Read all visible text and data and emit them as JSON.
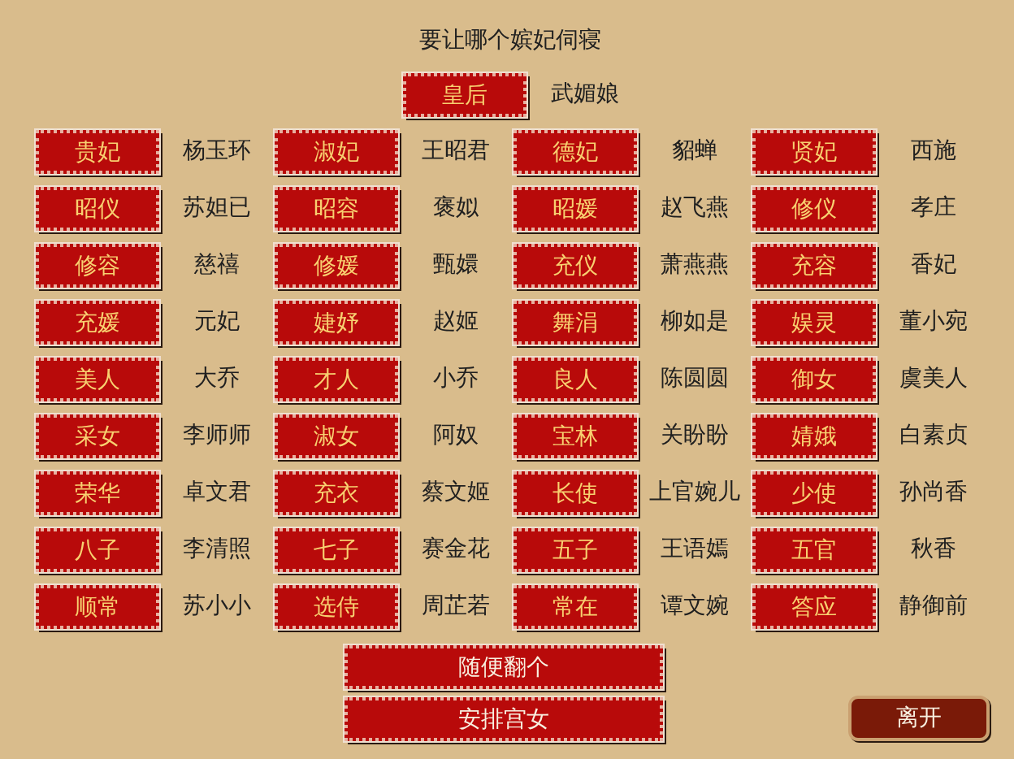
{
  "title": "要让哪个嫔妃伺寝",
  "featured": {
    "rank": "皇后",
    "name": "武媚娘"
  },
  "consorts": [
    {
      "rank": "贵妃",
      "name": "杨玉环"
    },
    {
      "rank": "淑妃",
      "name": "王昭君"
    },
    {
      "rank": "德妃",
      "name": "貂蝉"
    },
    {
      "rank": "贤妃",
      "name": "西施"
    },
    {
      "rank": "昭仪",
      "name": "苏妲已"
    },
    {
      "rank": "昭容",
      "name": "褒姒"
    },
    {
      "rank": "昭媛",
      "name": "赵飞燕"
    },
    {
      "rank": "修仪",
      "name": "孝庄"
    },
    {
      "rank": "修容",
      "name": "慈禧"
    },
    {
      "rank": "修媛",
      "name": "甄嬛"
    },
    {
      "rank": "充仪",
      "name": "萧燕燕"
    },
    {
      "rank": "充容",
      "name": "香妃"
    },
    {
      "rank": "充媛",
      "name": "元妃"
    },
    {
      "rank": "婕妤",
      "name": "赵姬"
    },
    {
      "rank": "舞涓",
      "name": "柳如是"
    },
    {
      "rank": "娱灵",
      "name": "董小宛"
    },
    {
      "rank": "美人",
      "name": "大乔"
    },
    {
      "rank": "才人",
      "name": "小乔"
    },
    {
      "rank": "良人",
      "name": "陈圆圆"
    },
    {
      "rank": "御女",
      "name": "虞美人"
    },
    {
      "rank": "采女",
      "name": "李师师"
    },
    {
      "rank": "淑女",
      "name": "阿奴"
    },
    {
      "rank": "宝林",
      "name": "关盼盼"
    },
    {
      "rank": "婧娥",
      "name": "白素贞"
    },
    {
      "rank": "荣华",
      "name": "卓文君"
    },
    {
      "rank": "充衣",
      "name": "蔡文姬"
    },
    {
      "rank": "长使",
      "name": "上官婉儿"
    },
    {
      "rank": "少使",
      "name": "孙尚香"
    },
    {
      "rank": "八子",
      "name": "李清照"
    },
    {
      "rank": "七子",
      "name": "赛金花"
    },
    {
      "rank": "五子",
      "name": "王语嫣"
    },
    {
      "rank": "五官",
      "name": "秋香"
    },
    {
      "rank": "顺常",
      "name": "苏小小"
    },
    {
      "rank": "选侍",
      "name": "周芷若"
    },
    {
      "rank": "常在",
      "name": "谭文婉"
    },
    {
      "rank": "答应",
      "name": "静御前"
    }
  ],
  "actions": [
    "随便翻个",
    "安排宫女"
  ],
  "exit": "离开"
}
